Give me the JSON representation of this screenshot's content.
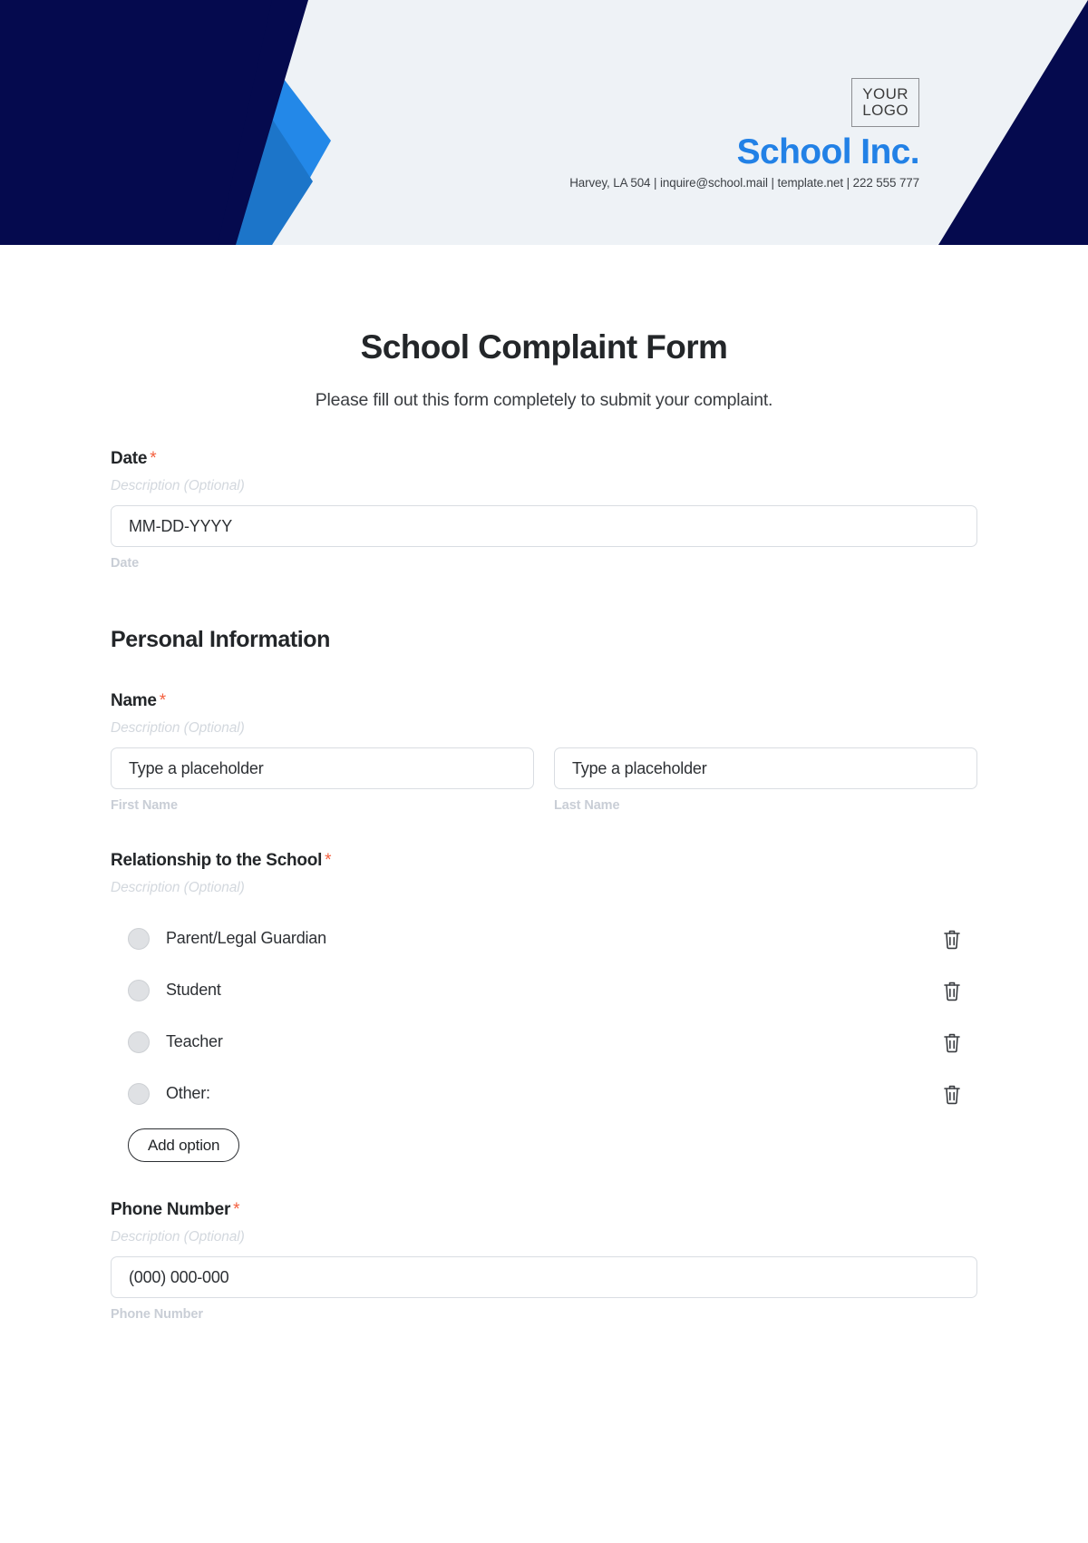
{
  "header": {
    "logo_line1": "YOUR",
    "logo_line2": "LOGO",
    "brand_name": "School Inc.",
    "contact": "Harvey, LA 504 | inquire@school.mail | template.net | 222 555 777",
    "colors": {
      "background": "#eef2f6",
      "navy": "#050a4e",
      "blue_light": "#2388e8",
      "blue_mid": "#1c75c9",
      "blue_dark": "#16609f",
      "brand_blue": "#2281e6"
    }
  },
  "form": {
    "title": "School Complaint Form",
    "subtitle": "Please fill out this form completely to submit your complaint.",
    "required_marker": "*",
    "description_placeholder": "Description (Optional)",
    "fields": {
      "date": {
        "label": "Date",
        "description": "Description (Optional)",
        "placeholder": "MM-DD-YYYY",
        "help": "Date"
      },
      "name": {
        "label": "Name",
        "description": "Description (Optional)",
        "first": {
          "placeholder": "Type a placeholder",
          "help": "First Name"
        },
        "last": {
          "placeholder": "Type a placeholder",
          "help": "Last Name"
        }
      },
      "relationship": {
        "label": "Relationship to the School",
        "description": "Description (Optional)",
        "options": [
          "Parent/Legal Guardian",
          "Student",
          "Teacher",
          "Other:"
        ],
        "add_option_label": "Add option"
      },
      "phone": {
        "label": "Phone Number",
        "description": "Description (Optional)",
        "placeholder": "(000) 000-000",
        "help": "Phone Number"
      }
    },
    "sections": {
      "personal_information": "Personal Information"
    }
  }
}
